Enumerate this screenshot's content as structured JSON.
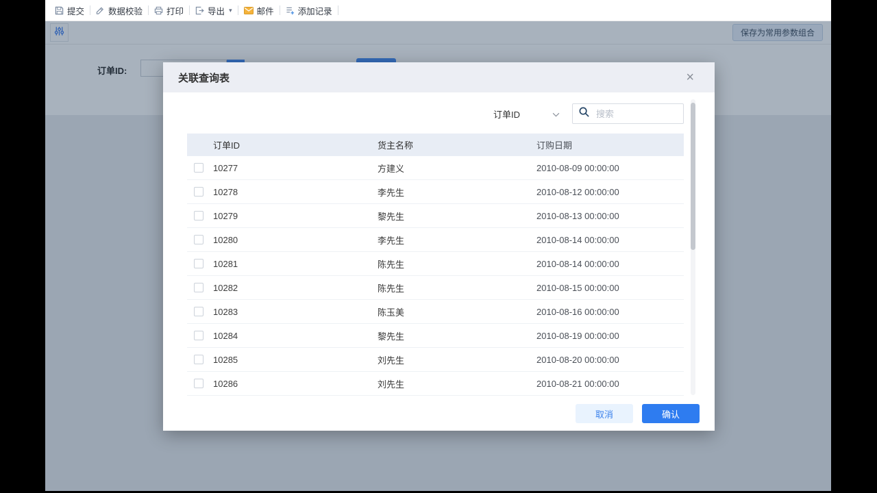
{
  "toolbar": {
    "items": [
      {
        "label": "提交",
        "icon": "save-icon",
        "has_dropdown": false
      },
      {
        "label": "数据校验",
        "icon": "validate-icon",
        "has_dropdown": false
      },
      {
        "label": "打印",
        "icon": "print-icon",
        "has_dropdown": false
      },
      {
        "label": "导出",
        "icon": "export-icon",
        "has_dropdown": true
      },
      {
        "label": "邮件",
        "icon": "mail-icon",
        "has_dropdown": false
      },
      {
        "label": "添加记录",
        "icon": "add-record-icon",
        "has_dropdown": false
      }
    ]
  },
  "filter_bar": {
    "save_preset_label": "保存为常用参数组合"
  },
  "background_form": {
    "order_id_label": "订单ID:"
  },
  "modal": {
    "title": "关联查询表",
    "close_icon": "×",
    "search": {
      "field_selector": "订单ID",
      "placeholder": "搜索"
    },
    "table": {
      "columns": [
        "订单ID",
        "货主名称",
        "订购日期"
      ],
      "rows": [
        {
          "order_id": "10277",
          "owner": "方建义",
          "date": "2010-08-09 00:00:00"
        },
        {
          "order_id": "10278",
          "owner": "李先生",
          "date": "2010-08-12 00:00:00"
        },
        {
          "order_id": "10279",
          "owner": "黎先生",
          "date": "2010-08-13 00:00:00"
        },
        {
          "order_id": "10280",
          "owner": "李先生",
          "date": "2010-08-14 00:00:00"
        },
        {
          "order_id": "10281",
          "owner": "陈先生",
          "date": "2010-08-14 00:00:00"
        },
        {
          "order_id": "10282",
          "owner": "陈先生",
          "date": "2010-08-15 00:00:00"
        },
        {
          "order_id": "10283",
          "owner": "陈玉美",
          "date": "2010-08-16 00:00:00"
        },
        {
          "order_id": "10284",
          "owner": "黎先生",
          "date": "2010-08-19 00:00:00"
        },
        {
          "order_id": "10285",
          "owner": "刘先生",
          "date": "2010-08-20 00:00:00"
        },
        {
          "order_id": "10286",
          "owner": "刘先生",
          "date": "2010-08-21 00:00:00"
        }
      ]
    },
    "footer": {
      "cancel_label": "取消",
      "confirm_label": "确认"
    }
  },
  "colors": {
    "primary": "#2e7cf0",
    "modal_header_bg": "#eceef4",
    "table_header_bg": "#e8edf5",
    "mail_icon": "#f5b33c",
    "overlay": "rgba(37,62,90,0.40)"
  }
}
